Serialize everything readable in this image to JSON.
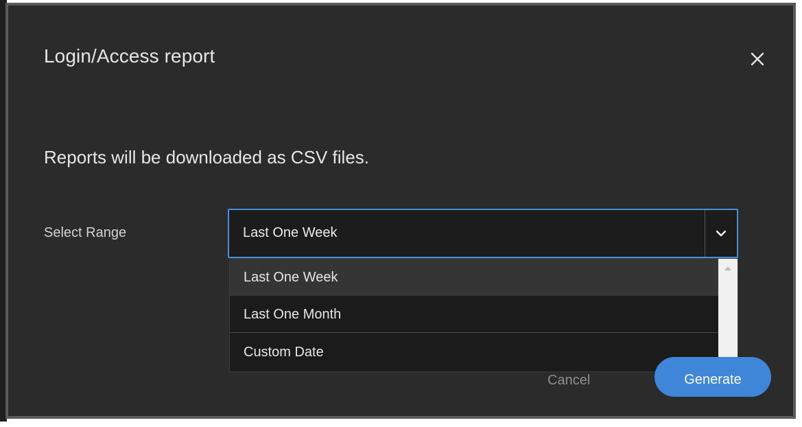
{
  "dialog": {
    "title": "Login/Access report",
    "description": "Reports will be downloaded as CSV files.",
    "close_icon": "close-icon"
  },
  "range": {
    "label": "Select Range",
    "selected": "Last One Week",
    "options": [
      {
        "label": "Last One Week",
        "highlighted": true
      },
      {
        "label": "Last One Month",
        "highlighted": false
      },
      {
        "label": "Custom Date",
        "highlighted": false
      }
    ],
    "dropdown_icon": "chevron-down-icon"
  },
  "actions": {
    "cancel_label": "Cancel",
    "generate_label": "Generate"
  },
  "colors": {
    "dialog_bg": "#2b2b2b",
    "accent": "#3f86d8",
    "select_border": "#4a8ed8"
  }
}
